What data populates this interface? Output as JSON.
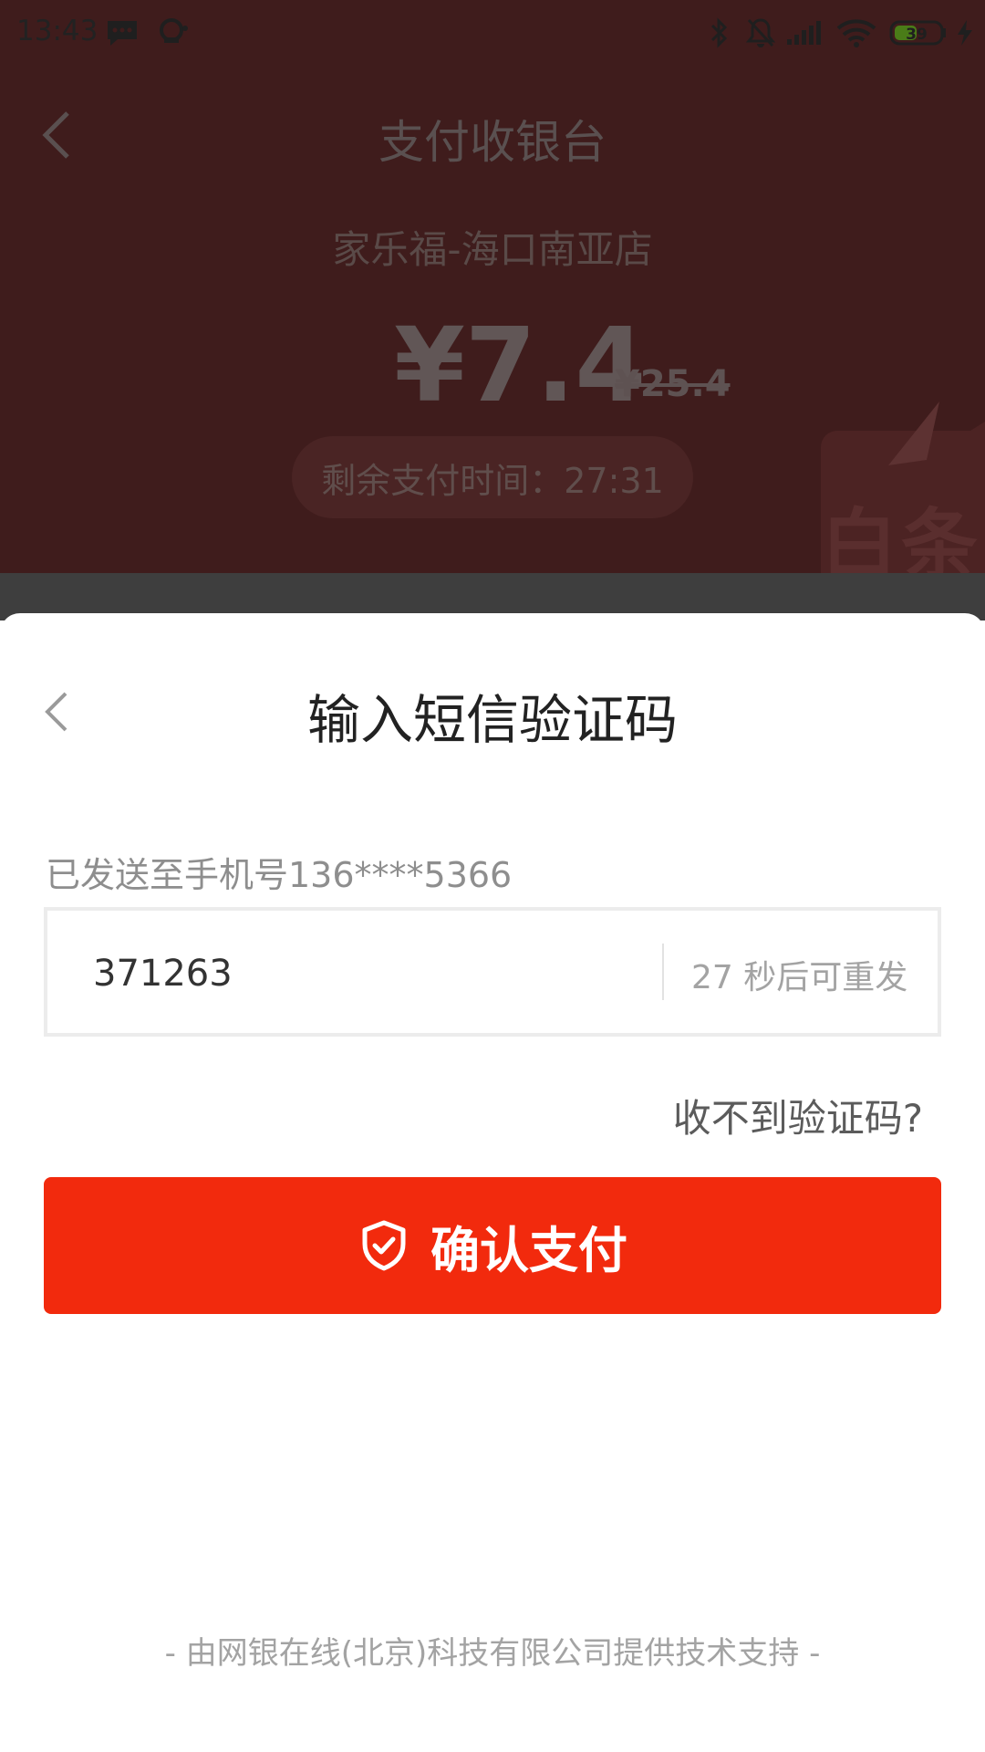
{
  "status_bar": {
    "time": "13:43",
    "battery": "39",
    "icons": [
      "message-icon",
      "headset-icon",
      "bluetooth-icon",
      "mute-icon",
      "signal-icon",
      "wifi-icon",
      "battery-icon",
      "charging-icon"
    ]
  },
  "cashier": {
    "title": "支付收银台",
    "store": "家乐福-海口南亚店",
    "amount": "¥7.4",
    "original_amount": "¥25.4",
    "timer": "剩余支付时间：27:31",
    "promo_badge": "白条"
  },
  "sms_sheet": {
    "title": "输入短信验证码",
    "sent_to": "已发送至手机号136****5366",
    "code_value": "371263",
    "resend_text": "27 秒后可重发",
    "no_code_link": "收不到验证码?",
    "confirm_label": "确认支付",
    "footer": "- 由网银在线(北京)科技有限公司提供技术支持 -"
  },
  "colors": {
    "primary": "#f22a0d",
    "overlay_top": "#3f1c1c",
    "overlay_gap": "#3e3e3e"
  }
}
